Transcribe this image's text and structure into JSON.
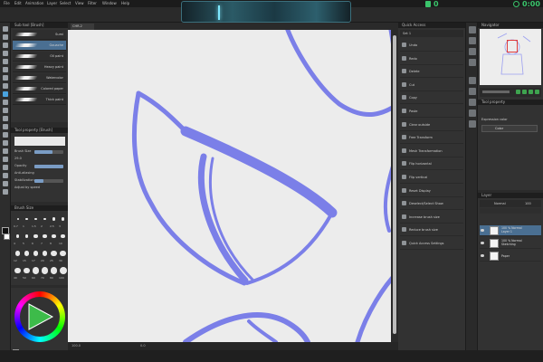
{
  "menu": {
    "items": [
      "File",
      "Edit",
      "Animation",
      "Layer",
      "Select",
      "View",
      "Filter",
      "Window",
      "Help"
    ]
  },
  "toolbar": {
    "counter": "0",
    "clock": "0:00"
  },
  "canvas": {
    "tab_label": "CHR-2"
  },
  "subtool": {
    "title": "Sub tool [Brush]",
    "brushes": [
      "Sumi",
      "Gouache",
      "Oil paint",
      "Heavy paint",
      "Watercolor",
      "Colored paper",
      "Thick paint"
    ],
    "selected_index": 1
  },
  "tool_property": {
    "title": "Tool property [Brush]",
    "brush_size_label": "Brush Size",
    "size_value": "29.0",
    "opacity_label": "Opacity",
    "antialiasing_label": "Anti-aliasing",
    "stabilization_label": "Stabilization",
    "adjust_label": "Adjust by speed"
  },
  "brush_size": {
    "title": "Brush Size",
    "sizes": [
      "0.7",
      "1",
      "1.5",
      "2",
      "2.5",
      "3",
      "4",
      "5",
      "6",
      "7",
      "8",
      "10",
      "12",
      "15",
      "17",
      "20",
      "25",
      "30",
      "40",
      "50",
      "60",
      "70",
      "80",
      "100"
    ]
  },
  "quick_access": {
    "title": "Quick Access",
    "set_label": "Set 1",
    "items": [
      "Undo",
      "Redo",
      "Delete",
      "Cut",
      "Copy",
      "Paste",
      "Clear outside",
      "Free Transform",
      "Mesh Transformation",
      "Flip horizontal",
      "Flip vertical",
      "Reset Display",
      "Deselect/Select Show",
      "Increase brush size",
      "Reduce brush size",
      "Quick Access Settings"
    ]
  },
  "navigator": {
    "title": "Navigator"
  },
  "sub_view": {
    "title": "Tool property",
    "expression_label": "Expression color",
    "expression_value": "Color"
  },
  "layers": {
    "title": "Layer",
    "blend_mode": "Normal",
    "opacity": "100",
    "items": [
      {
        "name": "100 % Normal",
        "sub": "Layer 1",
        "selected": true
      },
      {
        "name": "100 % Normal",
        "sub": "Sketching",
        "selected": false
      },
      {
        "name": "Paper",
        "sub": "",
        "selected": false
      }
    ]
  },
  "status": {
    "zoom": "100.0",
    "rotation": "0.0"
  },
  "colors": {
    "stroke": "#7b7fe8",
    "canvas_bg": "#ececec",
    "selection": "#4a6f92",
    "accent_green": "#3ac46b"
  }
}
